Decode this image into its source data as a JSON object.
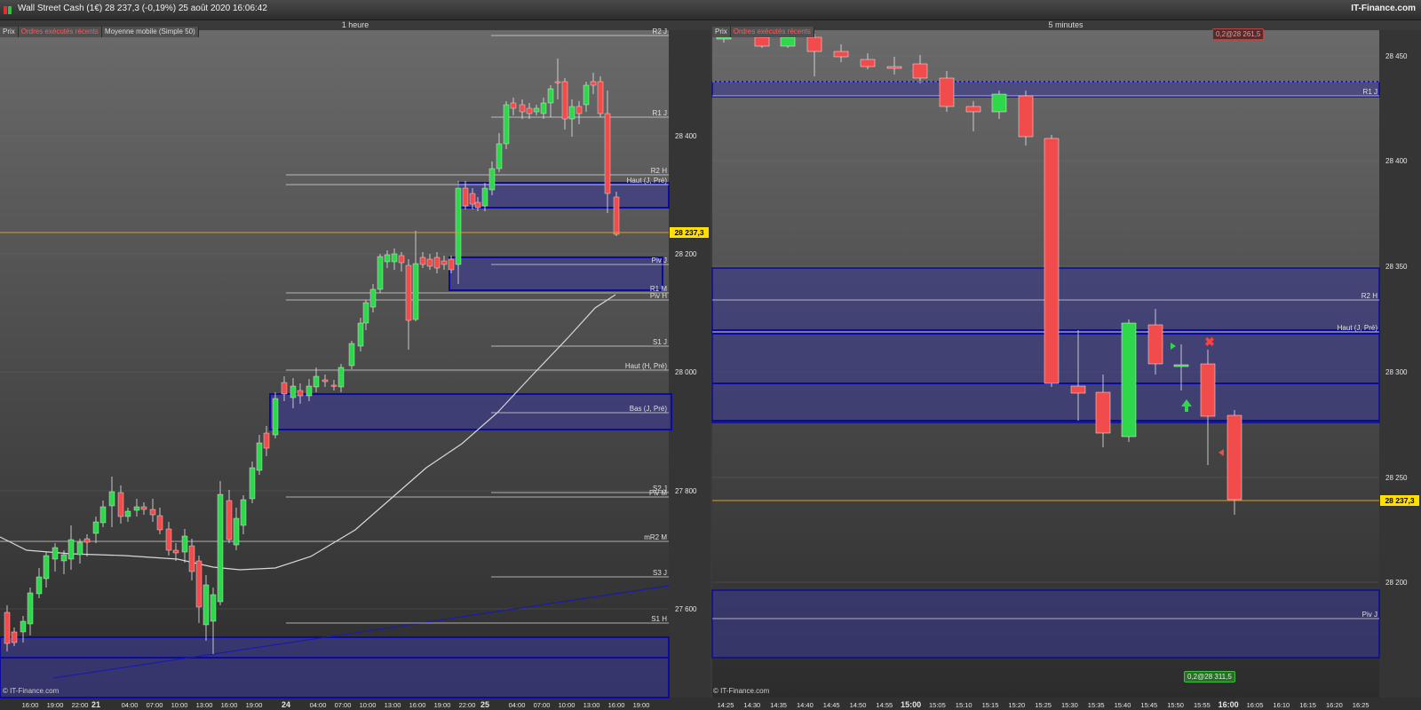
{
  "window": {
    "title": "Wall Street Cash (1€)   28 237,3 (-0,19%)   25 août 2020 16:06:42",
    "brand": "IT-Finance.com"
  },
  "colors": {
    "up": "#2fd84a",
    "down": "#f24b4b",
    "zone": "#3a3a8e",
    "zone_border": "#0b0b9e",
    "price_line": "#e0a020",
    "price_badge": "#ffe000"
  },
  "left_chart": {
    "timeframe": "1 heure",
    "toolbar": [
      {
        "label": "Prix"
      },
      {
        "label": "Ordres exécutés récents"
      },
      {
        "label": "Moyenne mobile (Simple 50)"
      }
    ],
    "current_price_label": "28 237,3",
    "y_ticks": [
      "28 400",
      "28 200",
      "28 000",
      "27 800",
      "27 600"
    ],
    "x_ticks": [
      "16:00",
      "19:00",
      "22:00",
      "21",
      "04:00",
      "07:00",
      "10:00",
      "13:00",
      "16:00",
      "19:00",
      "24",
      "04:00",
      "07:00",
      "10:00",
      "13:00",
      "16:00",
      "19:00",
      "22:00",
      "25",
      "04:00",
      "07:00",
      "10:00",
      "13:00",
      "16:00",
      "19:00"
    ],
    "levels": [
      "R2 J",
      "R1 J",
      "R2 H",
      "Haut (J, Pré)",
      "Piv J",
      "R1 M",
      "Piv H",
      "S1 J",
      "Haut (H, Pré)",
      "Bas (J, Pré)",
      "S2 J",
      "Piv M",
      "mR2 M",
      "S3 J",
      "S1 H"
    ],
    "copyright": "© IT-Finance.com"
  },
  "right_chart": {
    "timeframe": "5 minutes",
    "toolbar": [
      {
        "label": "Prix"
      },
      {
        "label": "Ordres exécutés récents"
      }
    ],
    "current_price_label": "28 237,3",
    "top_order_badge": "0,2@28 261,5",
    "bottom_order_badge": "0,2@28 311,5",
    "y_ticks": [
      "28 450",
      "28 400",
      "28 350",
      "28 300",
      "28 250",
      "28 200"
    ],
    "x_ticks": [
      "14:25",
      "14:30",
      "14:35",
      "14:40",
      "14:45",
      "14:50",
      "14:55",
      "15:00",
      "15:05",
      "15:10",
      "15:15",
      "15:20",
      "15:25",
      "15:30",
      "15:35",
      "15:40",
      "15:45",
      "15:50",
      "15:55",
      "16:00",
      "16:05",
      "16:10",
      "16:15",
      "16:20",
      "16:25"
    ],
    "levels": [
      "R1 J",
      "R2 H",
      "Haut (J, Pré)",
      "Piv J"
    ],
    "copyright": "© IT-Finance.com"
  }
}
